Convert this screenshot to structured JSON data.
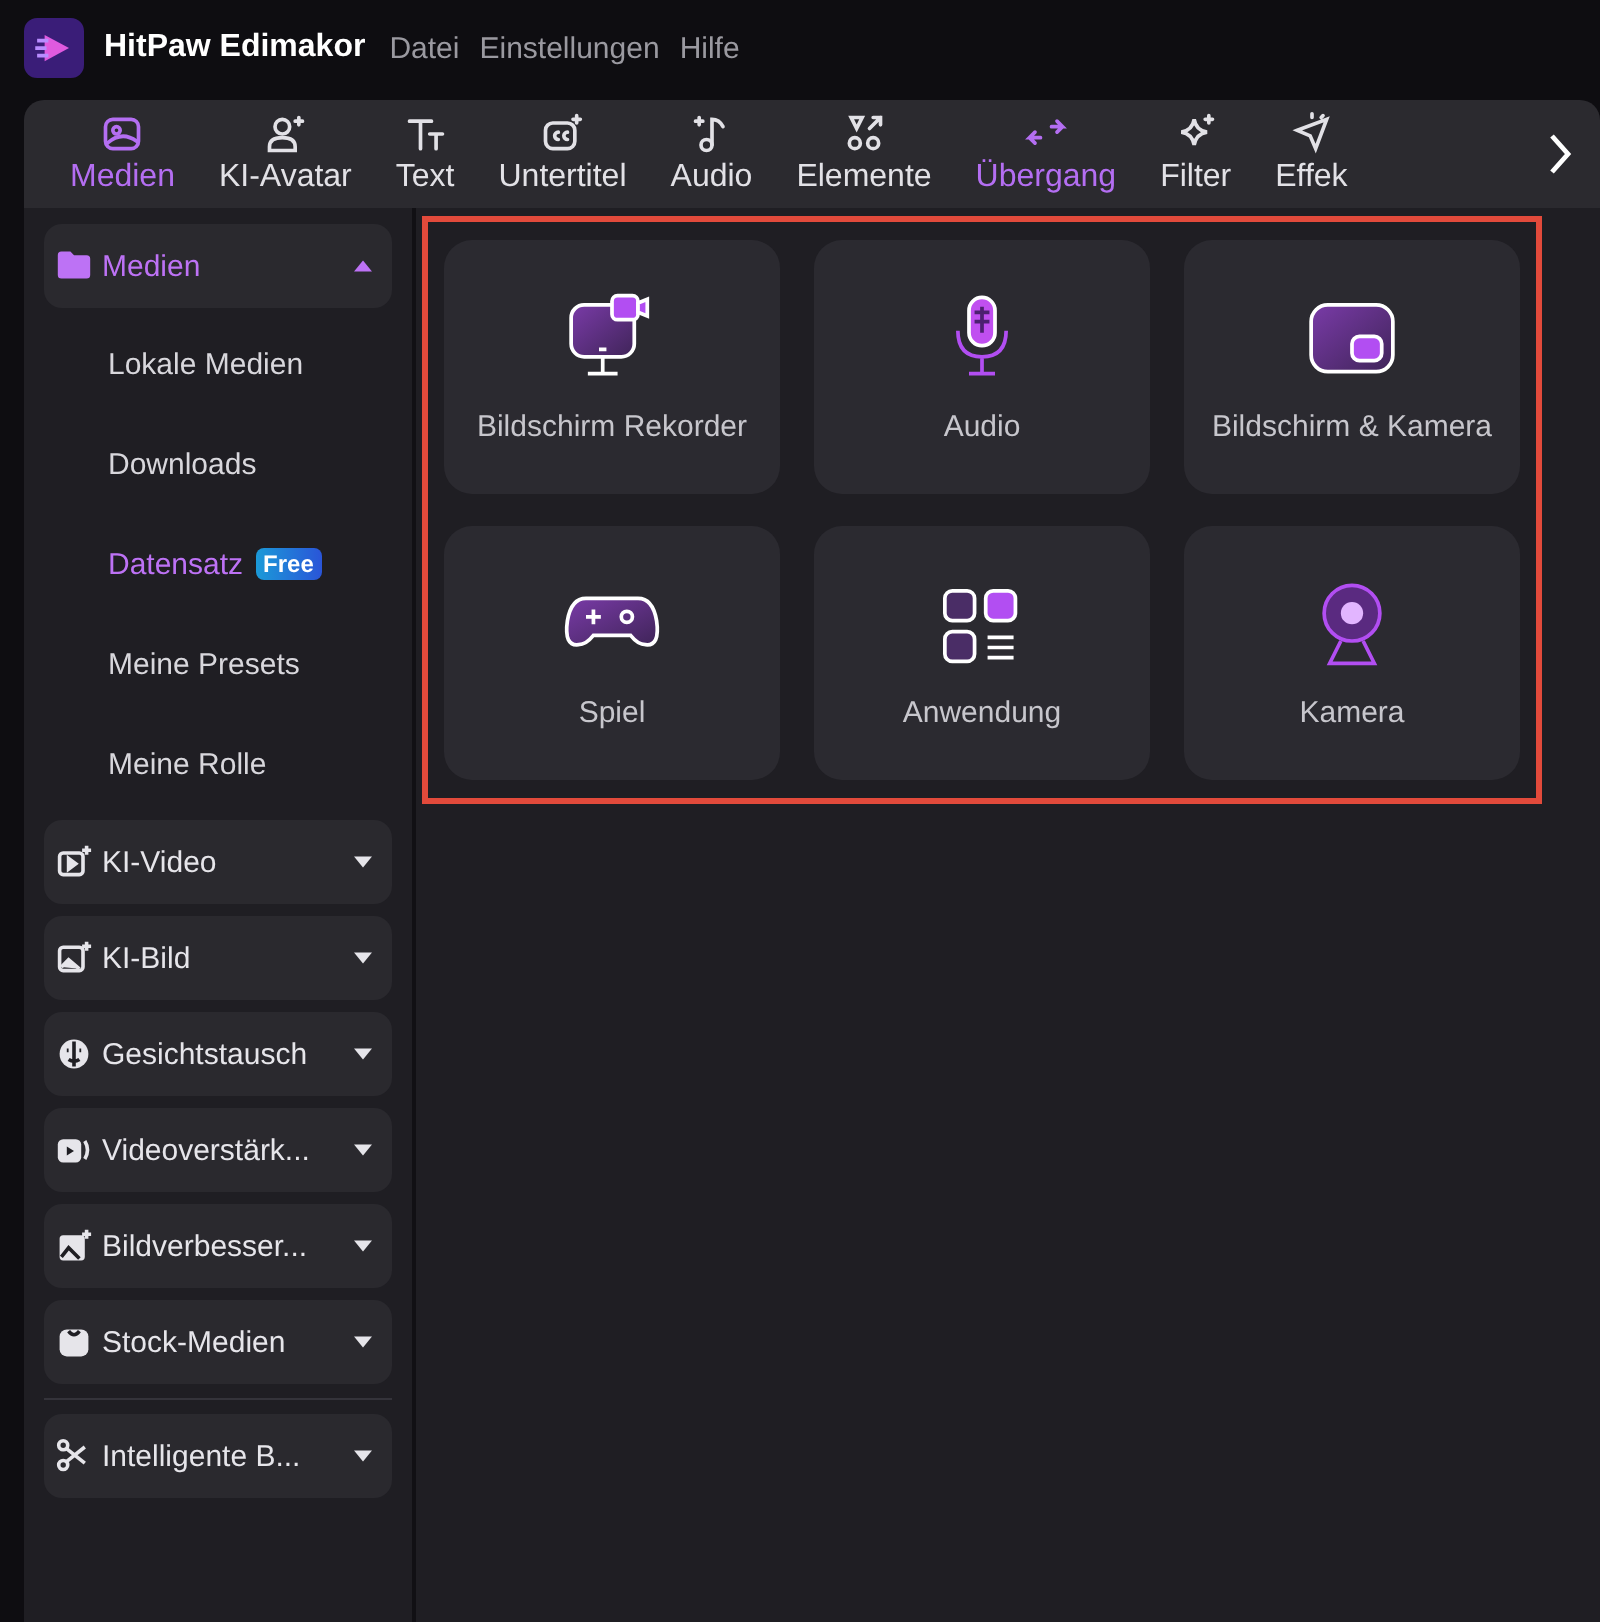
{
  "app": {
    "name": "HitPaw Edimakor"
  },
  "menu": [
    "Datei",
    "Einstellungen",
    "Hilfe"
  ],
  "tabs": [
    {
      "label": "Medien",
      "kind": "media",
      "selected": true
    },
    {
      "label": "KI-Avatar",
      "kind": "avatar",
      "selected": false
    },
    {
      "label": "Text",
      "kind": "text",
      "selected": false
    },
    {
      "label": "Untertitel",
      "kind": "cc",
      "selected": false
    },
    {
      "label": "Audio",
      "kind": "note",
      "selected": false
    },
    {
      "label": "Elemente",
      "kind": "elements",
      "selected": false
    },
    {
      "label": "Übergang",
      "kind": "transition",
      "selected": true
    },
    {
      "label": "Filter",
      "kind": "sparkle",
      "selected": false
    },
    {
      "label": "Effek",
      "kind": "effect",
      "selected": false
    }
  ],
  "sidebar": {
    "groups": [
      {
        "label": "Medien",
        "kind": "folder",
        "expanded": true,
        "children": [
          {
            "label": "Lokale Medien",
            "selected": false
          },
          {
            "label": "Downloads",
            "selected": false
          },
          {
            "label": "Datensatz",
            "badge": "Free",
            "selected": true
          },
          {
            "label": "Meine Presets",
            "selected": false
          },
          {
            "label": "Meine Rolle",
            "selected": false
          }
        ]
      },
      {
        "label": "KI-Video",
        "kind": "aivideo",
        "expanded": false
      },
      {
        "label": "KI-Bild",
        "kind": "aiimage",
        "expanded": false
      },
      {
        "label": "Gesichtstausch",
        "kind": "face",
        "expanded": false
      },
      {
        "label": "Videoverstärk...",
        "kind": "enhance",
        "expanded": false
      },
      {
        "label": "Bildverbesser...",
        "kind": "imgenh",
        "expanded": false
      },
      {
        "label": "Stock-Medien",
        "kind": "bag",
        "expanded": false
      },
      {
        "label": "Intelligente B...",
        "kind": "scissors",
        "expanded": false,
        "divider_before": true
      }
    ]
  },
  "recorders": {
    "highlighted": true,
    "items": [
      {
        "label": "Bildschirm Rekorder",
        "kind": "screen"
      },
      {
        "label": "Audio",
        "kind": "mic"
      },
      {
        "label": "Bildschirm & Kamera",
        "kind": "pip"
      },
      {
        "label": "Spiel",
        "kind": "gamepad"
      },
      {
        "label": "Anwendung",
        "kind": "apps"
      },
      {
        "label": "Kamera",
        "kind": "webcam"
      }
    ]
  }
}
